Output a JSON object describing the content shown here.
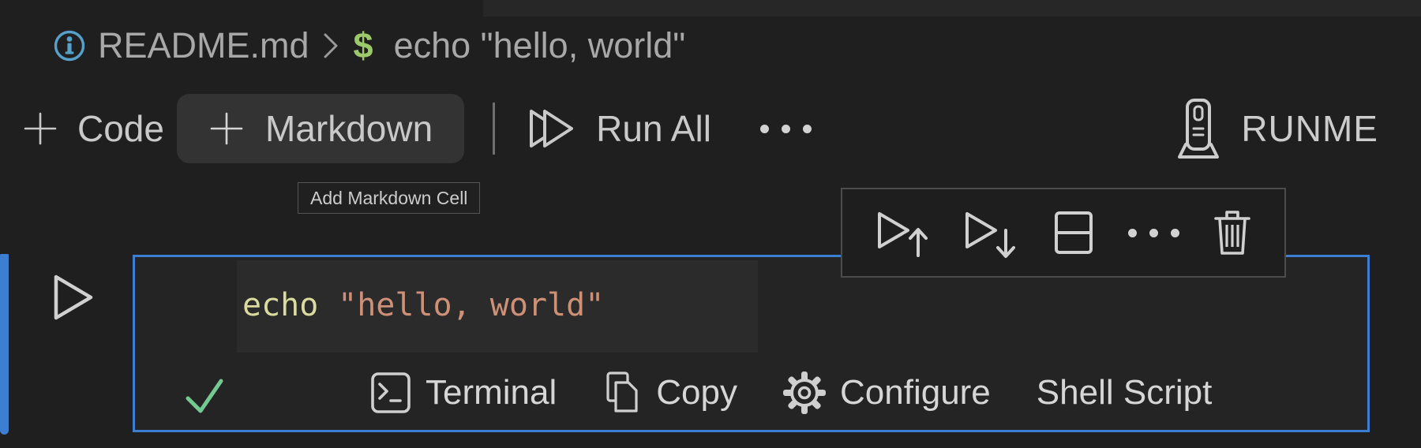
{
  "breadcrumb": {
    "file": "README.md",
    "separator": ">",
    "symbol": "$",
    "command": "echo \"hello, world\""
  },
  "notebook_toolbar": {
    "add_code_label": "Code",
    "add_markdown_label": "Markdown",
    "run_all_label": "Run All",
    "kernel_label": "RUNME"
  },
  "tooltip": {
    "text": "Add Markdown Cell"
  },
  "cell_toolbar": {
    "buttons": [
      {
        "name": "execute-above"
      },
      {
        "name": "execute-cell-and-below"
      },
      {
        "name": "split-cell"
      },
      {
        "name": "more-actions"
      },
      {
        "name": "delete-cell"
      }
    ]
  },
  "cell": {
    "code": {
      "command": "echo",
      "string": "\"hello, world\""
    },
    "status_bar": {
      "terminal_label": "Terminal",
      "copy_label": "Copy",
      "configure_label": "Configure",
      "language_label": "Shell Script"
    }
  },
  "colors": {
    "background": "#1f1f1f",
    "tabstrip": "#272727",
    "cell_background": "#242424",
    "line_highlight": "#2b2b2b",
    "focus_blue": "#3b7ed2",
    "info_blue": "#56a0c9",
    "symbol_green": "#9cc96a",
    "check_green": "#73c991",
    "command_yellow": "#dadc9f",
    "string_orange": "#ce9178",
    "ui_text": "#c9c9c9",
    "hover_background": "#333333"
  }
}
